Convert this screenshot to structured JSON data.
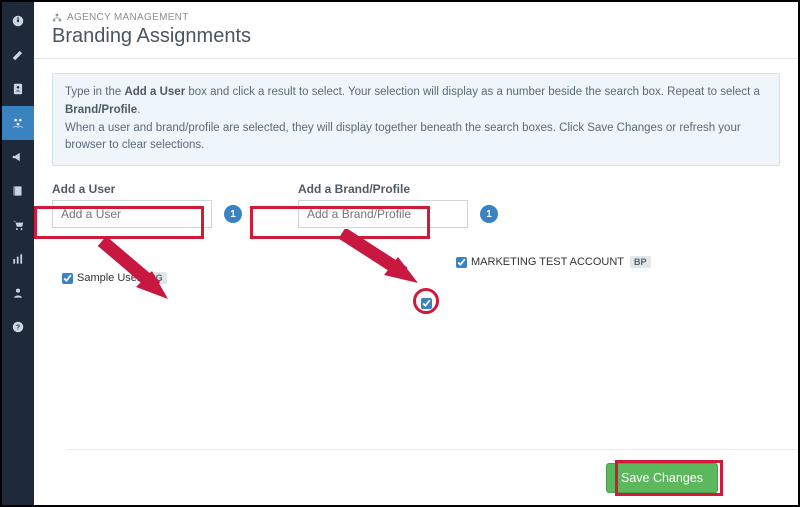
{
  "sidebar": {
    "items": [
      {
        "name": "dashboard"
      },
      {
        "name": "edit"
      },
      {
        "name": "contact"
      },
      {
        "name": "agency",
        "active": true
      },
      {
        "name": "announce"
      },
      {
        "name": "book"
      },
      {
        "name": "cart"
      },
      {
        "name": "stats"
      },
      {
        "name": "user"
      },
      {
        "name": "help"
      }
    ]
  },
  "header": {
    "crumb": "AGENCY MANAGEMENT",
    "title": "Branding Assignments"
  },
  "panel": {
    "line1a": "Type in the ",
    "line1b": "Add a User",
    "line1c": " box and click a result to select. Your selection will display as a number beside the search box. Repeat to select a ",
    "line1d": "Brand/Profile",
    "line1e": ".",
    "line2": "When a user and brand/profile are selected, they will display together beneath the search boxes. Click Save Changes or refresh your browser to clear selections."
  },
  "userCol": {
    "label": "Add a User",
    "placeholder": "Add a User",
    "badge": "1",
    "selected": {
      "name": "Sample User",
      "chip": "6G"
    }
  },
  "brandCol": {
    "label": "Add a Brand/Profile",
    "placeholder": "Add a Brand/Profile",
    "badge": "1",
    "selected": {
      "name": "MARKETING TEST ACCOUNT",
      "chip": "BP"
    }
  },
  "footer": {
    "save": "Save Changes"
  },
  "annotations": {
    "highlight_color": "#d11a3a"
  }
}
